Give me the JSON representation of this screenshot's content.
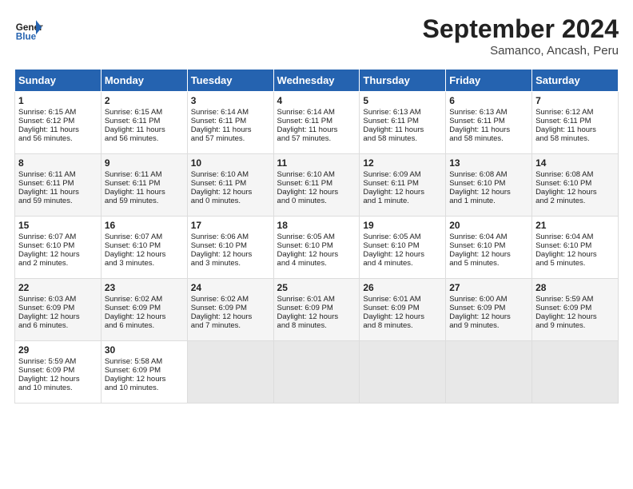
{
  "header": {
    "title": "September 2024",
    "subtitle": "Samanco, Ancash, Peru"
  },
  "columns": [
    "Sunday",
    "Monday",
    "Tuesday",
    "Wednesday",
    "Thursday",
    "Friday",
    "Saturday"
  ],
  "weeks": [
    [
      {
        "day": "1",
        "info": "Sunrise: 6:15 AM\nSunset: 6:12 PM\nDaylight: 11 hours\nand 56 minutes."
      },
      {
        "day": "2",
        "info": "Sunrise: 6:15 AM\nSunset: 6:11 PM\nDaylight: 11 hours\nand 56 minutes."
      },
      {
        "day": "3",
        "info": "Sunrise: 6:14 AM\nSunset: 6:11 PM\nDaylight: 11 hours\nand 57 minutes."
      },
      {
        "day": "4",
        "info": "Sunrise: 6:14 AM\nSunset: 6:11 PM\nDaylight: 11 hours\nand 57 minutes."
      },
      {
        "day": "5",
        "info": "Sunrise: 6:13 AM\nSunset: 6:11 PM\nDaylight: 11 hours\nand 58 minutes."
      },
      {
        "day": "6",
        "info": "Sunrise: 6:13 AM\nSunset: 6:11 PM\nDaylight: 11 hours\nand 58 minutes."
      },
      {
        "day": "7",
        "info": "Sunrise: 6:12 AM\nSunset: 6:11 PM\nDaylight: 11 hours\nand 58 minutes."
      }
    ],
    [
      {
        "day": "8",
        "info": "Sunrise: 6:11 AM\nSunset: 6:11 PM\nDaylight: 11 hours\nand 59 minutes."
      },
      {
        "day": "9",
        "info": "Sunrise: 6:11 AM\nSunset: 6:11 PM\nDaylight: 11 hours\nand 59 minutes."
      },
      {
        "day": "10",
        "info": "Sunrise: 6:10 AM\nSunset: 6:11 PM\nDaylight: 12 hours\nand 0 minutes."
      },
      {
        "day": "11",
        "info": "Sunrise: 6:10 AM\nSunset: 6:11 PM\nDaylight: 12 hours\nand 0 minutes."
      },
      {
        "day": "12",
        "info": "Sunrise: 6:09 AM\nSunset: 6:11 PM\nDaylight: 12 hours\nand 1 minute."
      },
      {
        "day": "13",
        "info": "Sunrise: 6:08 AM\nSunset: 6:10 PM\nDaylight: 12 hours\nand 1 minute."
      },
      {
        "day": "14",
        "info": "Sunrise: 6:08 AM\nSunset: 6:10 PM\nDaylight: 12 hours\nand 2 minutes."
      }
    ],
    [
      {
        "day": "15",
        "info": "Sunrise: 6:07 AM\nSunset: 6:10 PM\nDaylight: 12 hours\nand 2 minutes."
      },
      {
        "day": "16",
        "info": "Sunrise: 6:07 AM\nSunset: 6:10 PM\nDaylight: 12 hours\nand 3 minutes."
      },
      {
        "day": "17",
        "info": "Sunrise: 6:06 AM\nSunset: 6:10 PM\nDaylight: 12 hours\nand 3 minutes."
      },
      {
        "day": "18",
        "info": "Sunrise: 6:05 AM\nSunset: 6:10 PM\nDaylight: 12 hours\nand 4 minutes."
      },
      {
        "day": "19",
        "info": "Sunrise: 6:05 AM\nSunset: 6:10 PM\nDaylight: 12 hours\nand 4 minutes."
      },
      {
        "day": "20",
        "info": "Sunrise: 6:04 AM\nSunset: 6:10 PM\nDaylight: 12 hours\nand 5 minutes."
      },
      {
        "day": "21",
        "info": "Sunrise: 6:04 AM\nSunset: 6:10 PM\nDaylight: 12 hours\nand 5 minutes."
      }
    ],
    [
      {
        "day": "22",
        "info": "Sunrise: 6:03 AM\nSunset: 6:09 PM\nDaylight: 12 hours\nand 6 minutes."
      },
      {
        "day": "23",
        "info": "Sunrise: 6:02 AM\nSunset: 6:09 PM\nDaylight: 12 hours\nand 6 minutes."
      },
      {
        "day": "24",
        "info": "Sunrise: 6:02 AM\nSunset: 6:09 PM\nDaylight: 12 hours\nand 7 minutes."
      },
      {
        "day": "25",
        "info": "Sunrise: 6:01 AM\nSunset: 6:09 PM\nDaylight: 12 hours\nand 8 minutes."
      },
      {
        "day": "26",
        "info": "Sunrise: 6:01 AM\nSunset: 6:09 PM\nDaylight: 12 hours\nand 8 minutes."
      },
      {
        "day": "27",
        "info": "Sunrise: 6:00 AM\nSunset: 6:09 PM\nDaylight: 12 hours\nand 9 minutes."
      },
      {
        "day": "28",
        "info": "Sunrise: 5:59 AM\nSunset: 6:09 PM\nDaylight: 12 hours\nand 9 minutes."
      }
    ],
    [
      {
        "day": "29",
        "info": "Sunrise: 5:59 AM\nSunset: 6:09 PM\nDaylight: 12 hours\nand 10 minutes."
      },
      {
        "day": "30",
        "info": "Sunrise: 5:58 AM\nSunset: 6:09 PM\nDaylight: 12 hours\nand 10 minutes."
      },
      {
        "day": "",
        "info": ""
      },
      {
        "day": "",
        "info": ""
      },
      {
        "day": "",
        "info": ""
      },
      {
        "day": "",
        "info": ""
      },
      {
        "day": "",
        "info": ""
      }
    ]
  ]
}
